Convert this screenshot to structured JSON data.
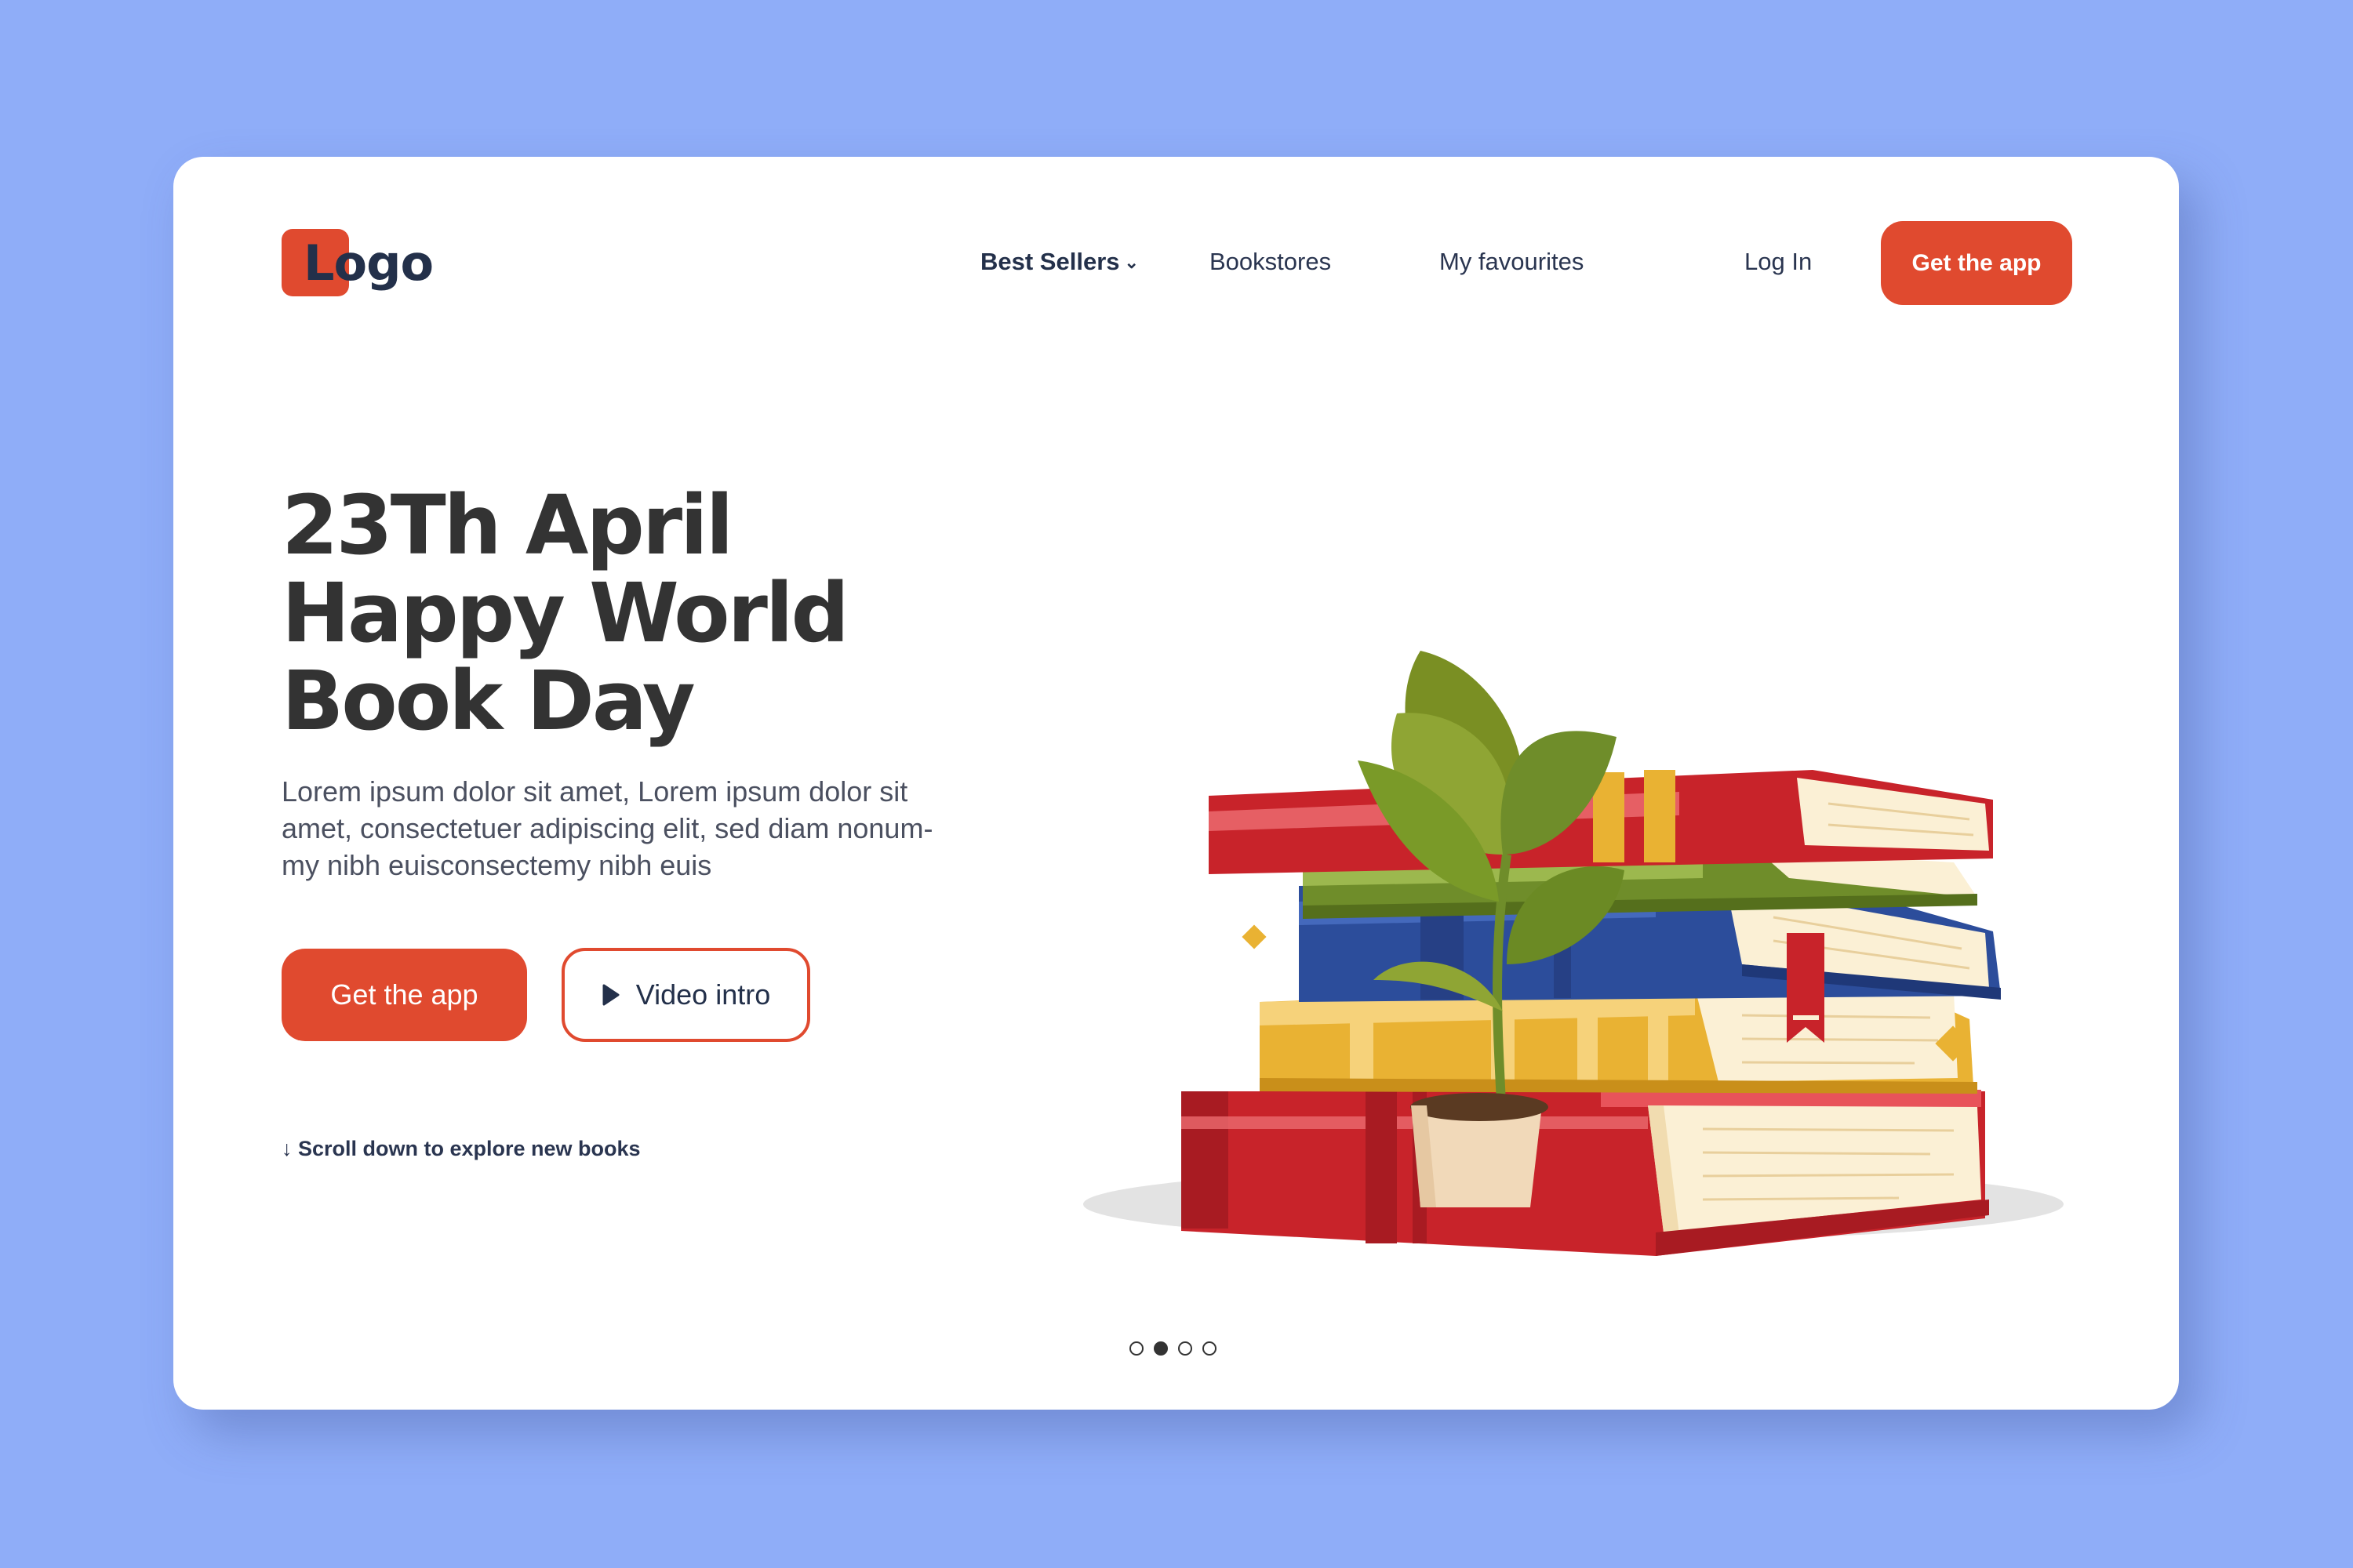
{
  "logo": {
    "text": "Logo"
  },
  "nav": {
    "items": [
      {
        "label": "Best Sellers",
        "has_dropdown": true
      },
      {
        "label": "Bookstores"
      },
      {
        "label": "My favourites"
      },
      {
        "label": "Log In"
      }
    ],
    "cta_label": "Get the app"
  },
  "hero": {
    "title_lines": [
      "23Th April",
      "Happy World",
      "Book Day"
    ],
    "description_lines": [
      "Lorem ipsum dolor sit amet, Lorem ipsum dolor sit",
      "amet, consectetuer adipiscing elit, sed diam nonum-",
      "my nibh euisconsectemy nibh euis"
    ],
    "primary_button": "Get the app",
    "video_button": "Video intro",
    "scroll_hint": "↓ Scroll down to explore new books"
  },
  "pagination": {
    "total": 4,
    "active_index": 1
  },
  "colors": {
    "background": "#8fadf8",
    "accent": "#e04a2f",
    "text_dark": "#333333",
    "nav_text": "#23304a"
  },
  "icons": [
    "chevron-down-icon",
    "play-icon",
    "arrow-down-icon"
  ]
}
